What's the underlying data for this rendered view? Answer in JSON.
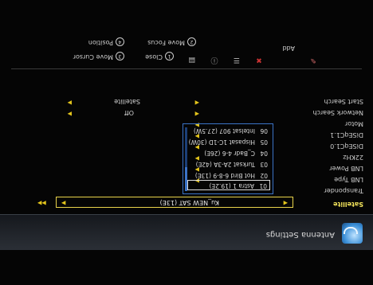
{
  "window": {
    "title": "Antenna Settings"
  },
  "settings": {
    "labels": [
      "Satellite",
      "Transponder",
      "LNB Type",
      "LNB Power",
      "22KHz",
      "DiSEqC1.0",
      "DiSEqC1.1",
      "Motor",
      "Network Search",
      "Start Search"
    ],
    "satellite_value": "Ku_NEW SAT (13E)",
    "network_search_value": "Off",
    "start_search_value": "Satellite"
  },
  "satellite_list": [
    {
      "num": "01",
      "name": "Astra 1 (19.2E)"
    },
    {
      "num": "02",
      "name": "Hot Bird 6-8-9 (13E)"
    },
    {
      "num": "03",
      "name": "Turksat 2A-3A (42E)"
    },
    {
      "num": "04",
      "name": "C_Badr 4-6 (26E)"
    },
    {
      "num": "05",
      "name": "Hispasat 1C-1D (30W)"
    },
    {
      "num": "06",
      "name": "Intelsat 907 (27.5W)"
    }
  ],
  "toolbar": {
    "add_label": "Add"
  },
  "footer": {
    "close": {
      "key": "1",
      "label": "Close"
    },
    "move_focus": {
      "key": "2",
      "label": "Move Focus"
    },
    "move_cursor": {
      "key": "3",
      "label": "Move Cursor"
    },
    "position": {
      "key": "4",
      "label": "Position"
    }
  },
  "colors": {
    "highlight": "#f2e35a",
    "arrows": "#e4c51c",
    "list_border": "#3b73c7"
  }
}
